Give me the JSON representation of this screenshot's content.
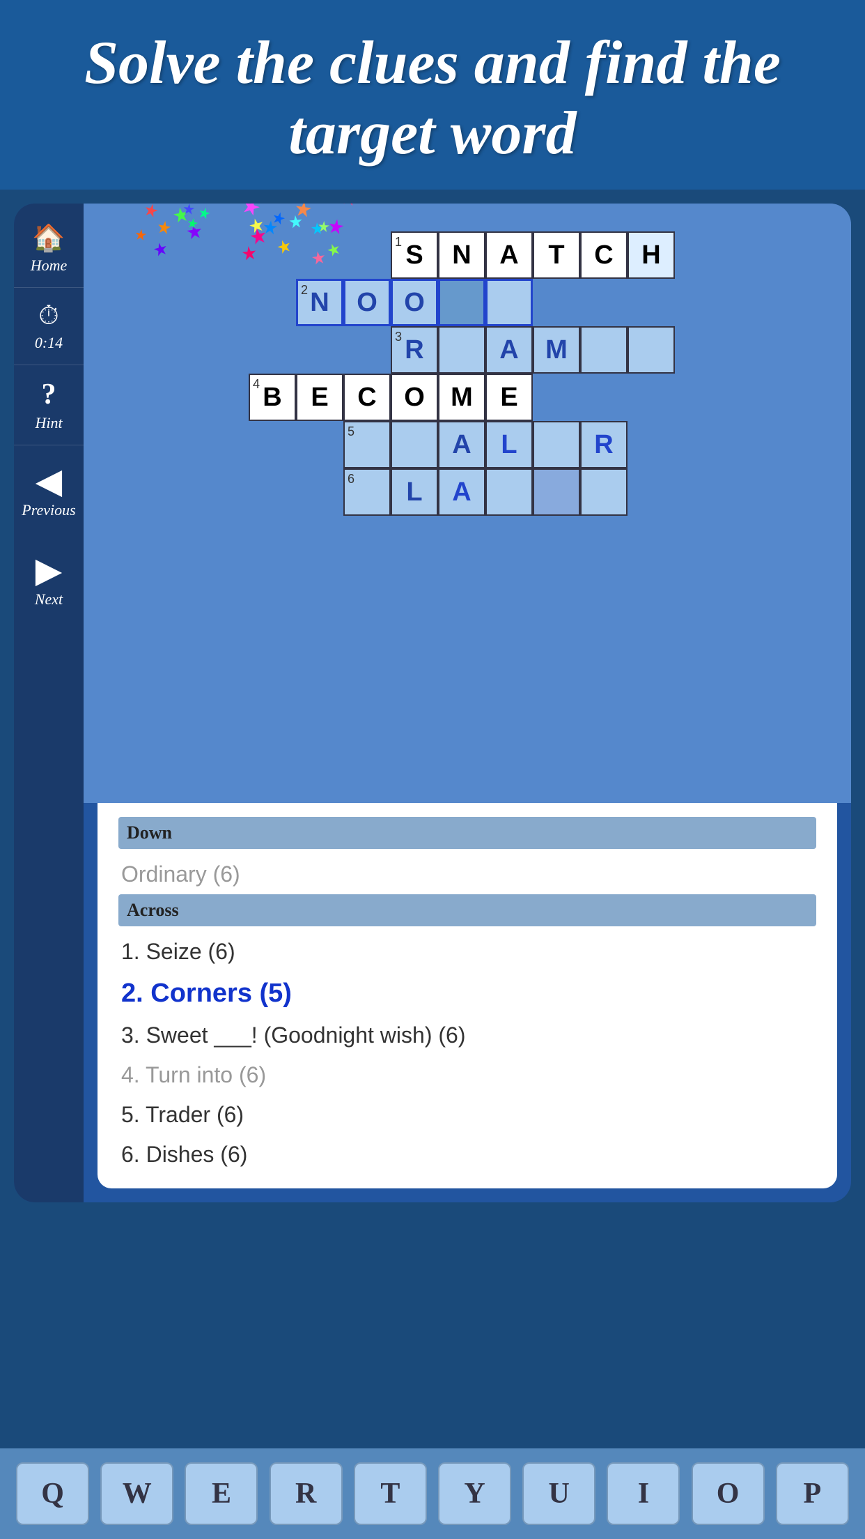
{
  "header": {
    "title": "Solve the clues and find the target word"
  },
  "sidebar": {
    "home_label": "Home",
    "timer": "0:14",
    "hint_label": "Hint",
    "previous_label": "Previous",
    "next_label": "Next"
  },
  "grid": {
    "row1": {
      "number": "1",
      "cells": [
        "S",
        "N",
        "A",
        "T",
        "C",
        "H"
      ]
    },
    "row2": {
      "number": "2",
      "cells": [
        "N",
        "O",
        "O",
        "",
        "",
        ""
      ]
    },
    "row3": {
      "number": "3",
      "cells": [
        "R",
        "",
        "A",
        "M",
        "",
        ""
      ]
    },
    "row4": {
      "number": "4",
      "cells": [
        "B",
        "E",
        "C",
        "O",
        "M",
        "E"
      ]
    },
    "row5": {
      "number": "5",
      "cells": [
        "",
        "A",
        "L",
        "",
        "R",
        ""
      ]
    },
    "row6": {
      "number": "6",
      "cells": [
        "L",
        "A",
        "",
        "",
        "",
        ""
      ]
    }
  },
  "clues": {
    "down_header": "Down",
    "down_items": [
      {
        "text": "Ordinary (6)",
        "active": false,
        "dark": false
      }
    ],
    "across_header": "Across",
    "across_items": [
      {
        "number": "1",
        "text": "Seize (6)",
        "active": false,
        "dark": true
      },
      {
        "number": "2",
        "text": "Corners (5)",
        "active": true,
        "dark": false
      },
      {
        "number": "3",
        "text": "Sweet ___! (Goodnight wish) (6)",
        "active": false,
        "dark": true
      },
      {
        "number": "4",
        "text": "Turn into (6)",
        "active": false,
        "dark": false
      },
      {
        "number": "5",
        "text": "Trader (6)",
        "active": false,
        "dark": true
      },
      {
        "number": "6",
        "text": "Dishes (6)",
        "active": false,
        "dark": true
      }
    ]
  },
  "keyboard": {
    "keys": [
      "Q",
      "W",
      "E",
      "R",
      "T",
      "Y",
      "U",
      "I",
      "O",
      "P"
    ]
  }
}
